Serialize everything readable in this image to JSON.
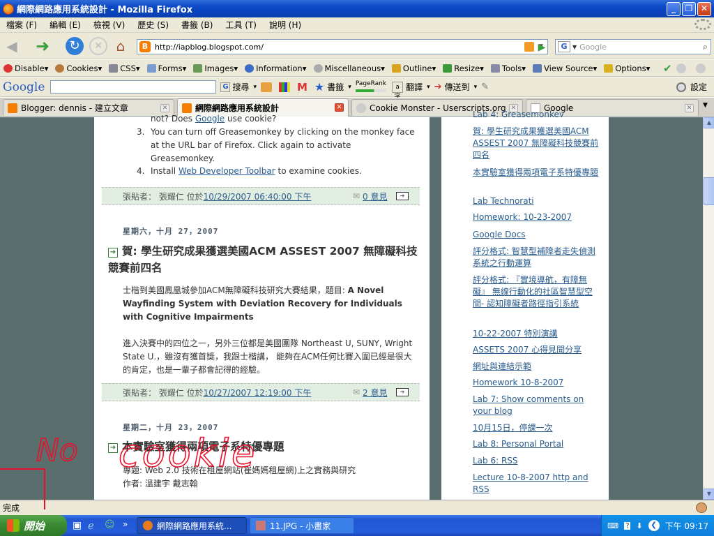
{
  "window": {
    "title": "網際網路應用系統設計 - Mozilla Firefox",
    "minimize_label": "_",
    "restore_label": "❐",
    "close_label": "✕"
  },
  "menu": [
    "檔案 (F)",
    "編輯 (E)",
    "檢視 (V)",
    "歷史 (S)",
    "書籤 (B)",
    "工具 (T)",
    "說明 (H)"
  ],
  "nav": {
    "url": "http://iapblog.blogspot.com/",
    "search_placeholder": "Google",
    "search_engine": "G"
  },
  "devbar": [
    "Disable▾",
    "Cookies▾",
    "CSS▾",
    "Forms▾",
    "Images▾",
    "Information▾",
    "Miscellaneous▾",
    "Outline▾",
    "Resize▾",
    "Tools▾",
    "View Source▾",
    "Options▾"
  ],
  "gbar": {
    "logo": "Google",
    "search_label": "搜尋",
    "bookmarks_label": "書籤",
    "pagerank_label": "PageRank",
    "translate_label": "翻譯",
    "sendto_label": "傳送到",
    "settings_label": "設定"
  },
  "tabs": [
    {
      "label": "Blogger: dennis - 建立文章",
      "active": false
    },
    {
      "label": "網際網路應用系統設計",
      "active": true
    },
    {
      "label": "Cookie Monster - Userscripts.org",
      "active": false
    },
    {
      "label": "Google",
      "active": false
    }
  ],
  "posts": {
    "top_list": {
      "line0": "not? Does ",
      "line0_link": "Google",
      "line0_end": " use cookie?",
      "item3_num": "3.",
      "item3": "You can turn off Greasemonkey by clicking on the monkey face at the URL bar of Firefox. Click again to activate Greasemonkey.",
      "item4_num": "4.",
      "item4_pre": "Install ",
      "item4_link": "Web Developer Toolbar",
      "item4_post": " to examine cookies."
    },
    "footer1": {
      "by": "張貼者： 張耀仁 位於 ",
      "time": "10/29/2007 06:40:00 下午",
      "comments": "0 意見"
    },
    "date2": "星期六，十月 27，2007",
    "title2": "賀: 學生研究成果獲選美國ACM ASSEST 2007 無障礙科技競賽前四名",
    "body2_p1_pre": "士楷到美國鳳凰城參加ACM無障礙科技研究大賽結果，題目: ",
    "body2_p1_bold": "A Novel Wayfinding System with Deviation Recovery for Individuals with Cognitive Impairments",
    "body2_p2": "進入決賽中的四位之一，另外三位都是美國團隊 Northeast U, SUNY, Wright State U.，雖沒有獲首獎，我跟士楷講， 能夠在ACM任何比賽入圍已經是很大的肯定，也是一輩子都會記得的經驗。",
    "footer2": {
      "by": "張貼者： 張耀仁 位於 ",
      "time": "10/27/2007 12:19:00 下午",
      "comments": "2 意見"
    },
    "date3": "星期二，十月 23，2007",
    "title3": "本實驗室獲得兩項電子系特優專題",
    "body3_l1": "專題: Web 2.0 技術在租屋網站(崔媽媽租屋網)上之實務與研究",
    "body3_l2": "作者: 溫建宇 戴志翰"
  },
  "sidebar": [
    "Lab 4: Greasemonkey",
    "賀: 學生研究成果獲選美國ACM ASSEST 2007 無障礙科技競賽前四名",
    "本實驗室獲得兩項電子系特優專題",
    "Lab Technorati",
    "Homework: 10-23-2007",
    "Google Docs",
    "評分格式: 智慧型補障者走失偵測系統之行動運算",
    "評分格式: 『實境導航，有障無礙』 無線行動化的社區智慧型空間- 認知障礙者路徑指引系統",
    "10-22-2007 特別演講",
    "ASSETS 2007 心得見聞分享",
    "網址與連結示範",
    "Homework 10-8-2007",
    "Lab 7: Show comments on your blog",
    "10月15日，停課一次",
    "Lab 8: Personal Portal",
    "Lab 6: RSS",
    "Lecture 10-8-2007 http and RSS"
  ],
  "status": "完成",
  "taskbar": {
    "start": "開始",
    "items": [
      "網際網路應用系統...",
      "11.JPG - 小畫家"
    ],
    "clock": "下午 09:17"
  },
  "annotation": {
    "text1": "No",
    "text2": "cookie",
    "color": "#e8102a"
  }
}
